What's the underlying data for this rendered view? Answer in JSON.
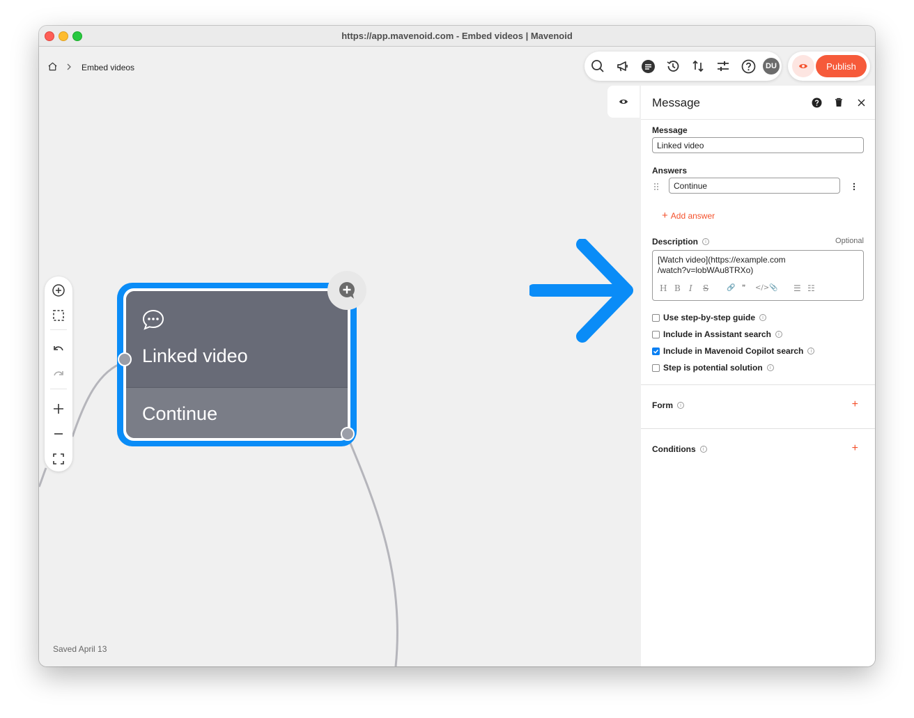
{
  "window": {
    "title": "https://app.mavenoid.com - Embed videos | Mavenoid"
  },
  "breadcrumb": {
    "home_icon": "home-icon",
    "current": "Embed videos"
  },
  "status": {
    "saved": "Saved April 13"
  },
  "toolbar": {
    "icons": [
      "search-icon",
      "megaphone-icon",
      "chat-icon",
      "history-icon",
      "sort-icon",
      "sliders-icon",
      "help-icon"
    ],
    "avatar": "DU",
    "publish_label": "Publish"
  },
  "node": {
    "title": "Linked video",
    "answer": "Continue"
  },
  "panel": {
    "title": "Message",
    "message_label": "Message",
    "message_value": "Linked video",
    "answers_label": "Answers",
    "answers": [
      "Continue"
    ],
    "add_answer": "Add answer",
    "description_label": "Description",
    "optional_label": "Optional",
    "description_line1": "[Watch video](https://example.com",
    "description_line2": "/watch?v=lobWAu8TRXo)",
    "md_tools": [
      "H",
      "B",
      "I",
      "S",
      "🔗",
      "❞",
      "</>",
      "📎",
      "☰",
      "☷"
    ],
    "checks": [
      {
        "label": "Use step-by-step guide",
        "checked": false
      },
      {
        "label": "Include in Assistant search",
        "checked": false
      },
      {
        "label": "Include in Mavenoid Copilot search",
        "checked": true
      },
      {
        "label": "Step is potential solution",
        "checked": false
      }
    ],
    "form_label": "Form",
    "conditions_label": "Conditions"
  },
  "colors": {
    "accent": "#f65a3a",
    "node_border": "#0a8cf7",
    "arrow": "#0a8cf7"
  }
}
